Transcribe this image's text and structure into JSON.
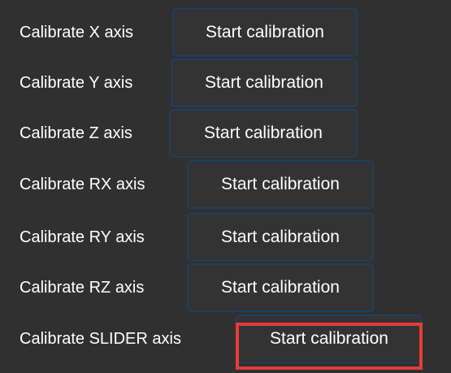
{
  "rows": [
    {
      "label": "Calibrate X axis",
      "button": "Start calibration"
    },
    {
      "label": "Calibrate Y axis",
      "button": "Start calibration"
    },
    {
      "label": "Calibrate Z axis",
      "button": "Start calibration"
    },
    {
      "label": "Calibrate RX axis",
      "button": "Start calibration"
    },
    {
      "label": "Calibrate RY axis",
      "button": "Start calibration"
    },
    {
      "label": "Calibrate RZ axis",
      "button": "Start calibration"
    },
    {
      "label": "Calibrate SLIDER axis",
      "button": "Start calibration"
    }
  ],
  "colors": {
    "background": "#303030",
    "button_border": "#1f3f5e",
    "highlight": "#e83a3a",
    "text": "#ffffff"
  }
}
